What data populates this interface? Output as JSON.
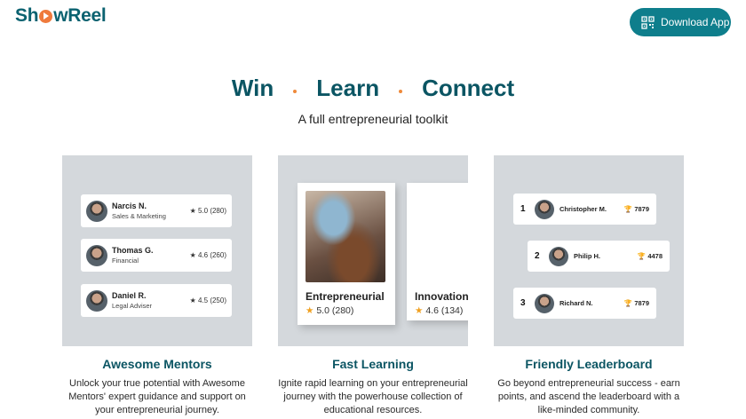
{
  "header": {
    "logo_prefix": "Sh",
    "logo_suffix": "wReel",
    "logo_icon": "play-circle-icon",
    "download_label": "Download App",
    "download_icon": "qr-code-icon"
  },
  "hero": {
    "words": [
      "Win",
      "Learn",
      "Connect"
    ],
    "subtitle": "A full entrepreneurial toolkit"
  },
  "colors": {
    "brand": "#0b6270",
    "accent": "#ef7a3c",
    "button": "#0e7e8c",
    "card_bg": "#d4d8dc"
  },
  "features": [
    {
      "title": "Awesome Mentors",
      "description": "Unlock your true potential with Awesome Mentors' expert guidance and support on your entrepreneurial journey.",
      "mentors": [
        {
          "name": "Narcis N.",
          "role": "Sales & Marketing",
          "rating": "★ 5.0 (280)"
        },
        {
          "name": "Thomas G.",
          "role": "Financial",
          "rating": "★ 4.6 (260)"
        },
        {
          "name": "Daniel R.",
          "role": "Legal Adviser",
          "rating": "★ 4.5 (250)"
        }
      ]
    },
    {
      "title": "Fast Learning",
      "description": "Ignite rapid learning on your entrepreneurial journey with the powerhouse collection of educational resources.",
      "courses": [
        {
          "title": "Entrepreneurial",
          "rating": "5.0 (280)"
        },
        {
          "title": "Innovation",
          "rating": "4.6 (134)"
        }
      ]
    },
    {
      "title": "Friendly Leaderboard",
      "description": "Go beyond entrepreneurial success - earn points, and ascend the leaderboard with a like-minded community.",
      "leaders": [
        {
          "rank": "1",
          "name": "Christopher M.",
          "points": "🏆 7879"
        },
        {
          "rank": "2",
          "name": "Philip H.",
          "points": "🏆 4478"
        },
        {
          "rank": "3",
          "name": "Richard N.",
          "points": "🏆 7879"
        }
      ]
    }
  ]
}
